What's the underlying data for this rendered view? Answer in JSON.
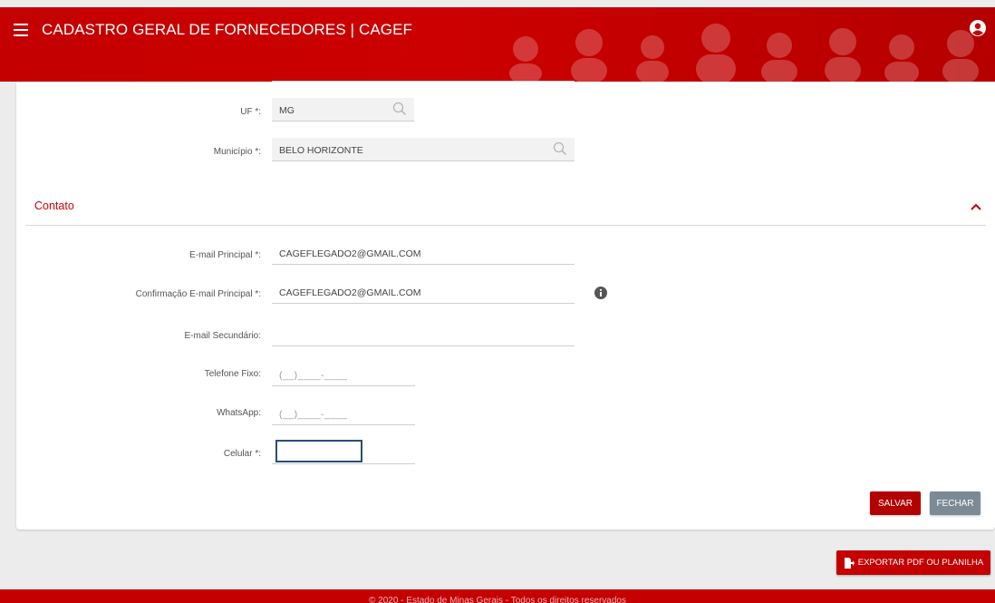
{
  "header": {
    "title": "CADASTRO GERAL DE FORNECEDORES | CAGEF",
    "menu_icon": "hamburger-menu-icon",
    "user_icon": "user-account-icon",
    "brand_color": "#cc0000"
  },
  "address": {
    "uf_label": "UF *:",
    "uf_value": "MG",
    "municipio_label": "Município *:",
    "municipio_value": "BELO HORIZONTE",
    "lookup_icon": "search-icon"
  },
  "contato": {
    "section_title": "Contato",
    "collapse_icon": "chevron-up-icon",
    "email_principal_label": "E-mail Principal *:",
    "email_principal_value": "CAGEFLEGADO2@GMAIL.COM",
    "email_confirm_label": "Confirmação E-mail Principal *:",
    "email_confirm_value": "CAGEFLEGADO2@GMAIL.COM",
    "info_icon": "info-icon",
    "email_secundario_label": "E-mail Secundário:",
    "email_secundario_value": "",
    "telefone_fixo_label": "Telefone Fixo:",
    "telefone_fixo_mask": "(__)____-____",
    "whatsapp_label": "WhatsApp:",
    "whatsapp_mask": "(__)____-____",
    "celular_label": "Celular *:",
    "celular_value": ""
  },
  "actions": {
    "save_label": "SALVAR",
    "close_label": "FECHAR",
    "export_label": "EXPORTAR PDF OU PLANILHA",
    "export_icon": "export-file-icon",
    "save_color": "#b30000",
    "close_color": "#7c8a96"
  },
  "footer": {
    "text": "© 2020 - Estado de Minas Gerais - Todos os direitos reservados"
  }
}
